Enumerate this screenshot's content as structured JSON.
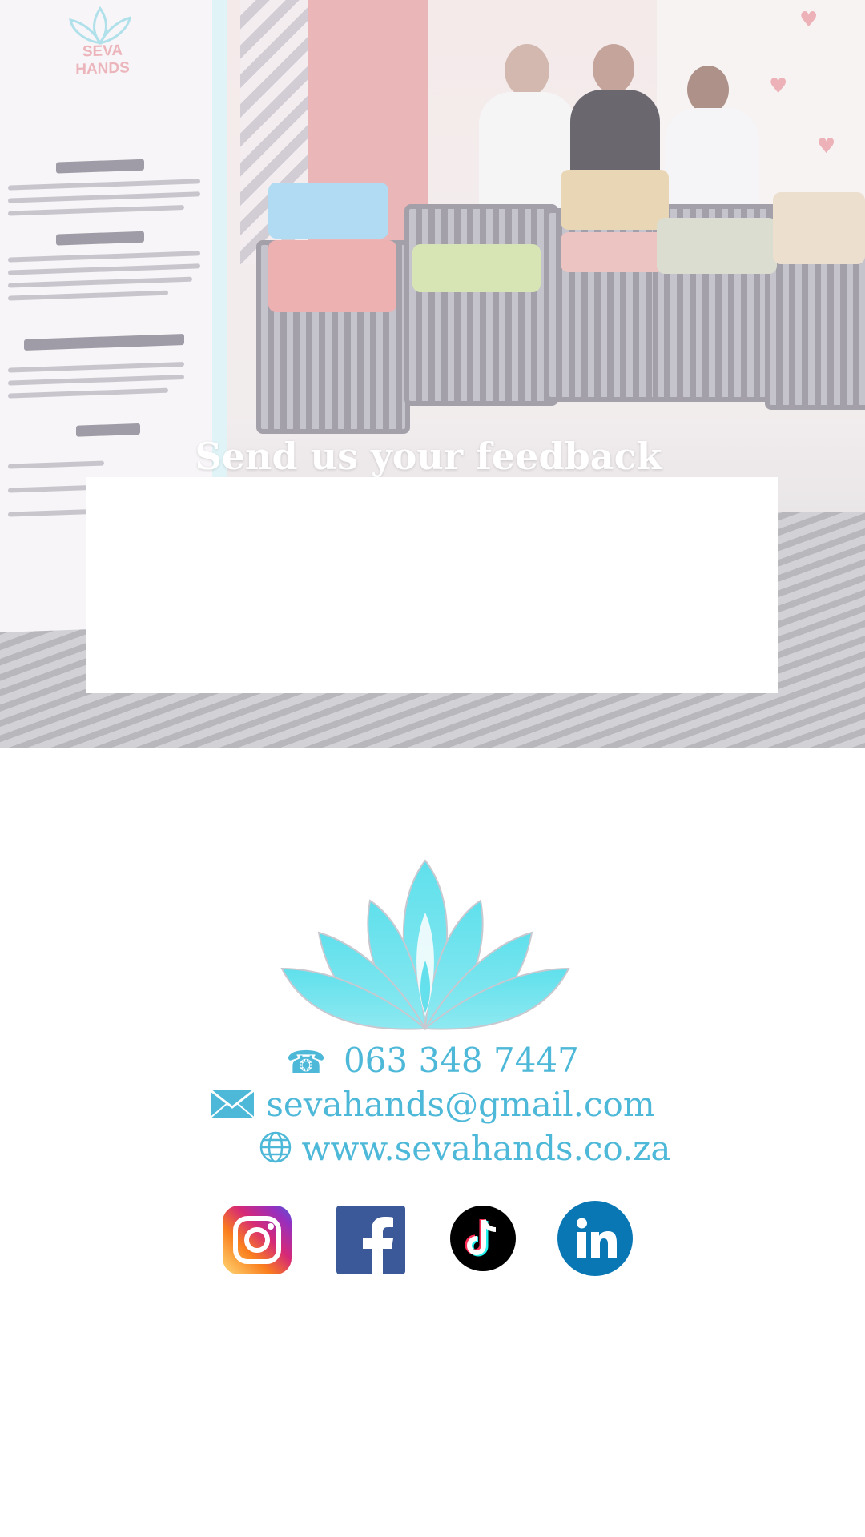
{
  "feedback": {
    "title": "Send us your feedback"
  },
  "banner": {
    "brand": "SEVA HANDS"
  },
  "contact": {
    "phone": "063 348 7447",
    "email": "sevahands@gmail.com",
    "website": "www.sevahands.co.za"
  },
  "icons": {
    "phone": "phone-icon",
    "email": "envelope-icon",
    "website": "globe-icon"
  },
  "social": [
    {
      "name": "instagram-icon"
    },
    {
      "name": "facebook-icon"
    },
    {
      "name": "tiktok-icon"
    },
    {
      "name": "linkedin-icon"
    }
  ],
  "colors": {
    "accent": "#4db8d8",
    "instagram": "#e1306c",
    "facebook": "#3b5998",
    "tiktok": "#000000",
    "linkedin": "#0a77b5"
  }
}
